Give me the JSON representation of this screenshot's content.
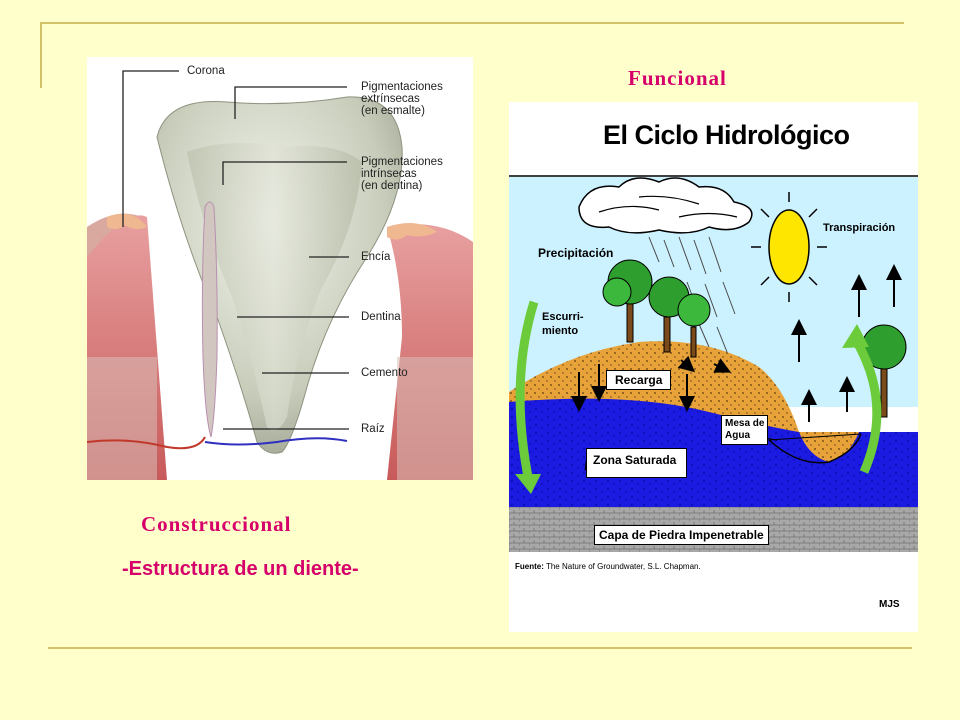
{
  "tooth_panel": {
    "labels": {
      "corona": "Corona",
      "pig_ext": "Pigmentaciones\nextrínsecas\n(en esmalte)",
      "pig_int": "Pigmentaciones\nintrínsecas\n(en dentina)",
      "encia": "Encía",
      "dentina": "Dentina",
      "cemento": "Cemento",
      "raiz": "Raíz"
    },
    "heading": "Construccional",
    "caption": "-Estructura de un diente-"
  },
  "cycle_panel": {
    "heading": "Funcional",
    "title": "El Ciclo Hidrológico",
    "labels": {
      "precipitacion": "Precipitación",
      "transpiracion": "Transpiración",
      "escurrimiento": "Escurri-\nmiento",
      "recarga": "Recarga",
      "mesa_agua": "Mesa de\nAgua",
      "zona_saturada": "Zona Saturada",
      "capa_piedra": "Capa de Piedra Impenetrable"
    },
    "source_prefix": "Fuente:",
    "source_text": "The Nature of Groundwater, S.L. Chapman.",
    "credit": "MJS"
  },
  "colors": {
    "background": "#FFFFCC",
    "accent": "#D6006A",
    "rule": "#D4C26A",
    "sky": "#CCF2FF",
    "soil": "#E8A23A",
    "water": "#1A1AE0",
    "rock": "#9E9E9E",
    "sun": "#FFE600",
    "arrow_green": "#6CCB3A"
  }
}
